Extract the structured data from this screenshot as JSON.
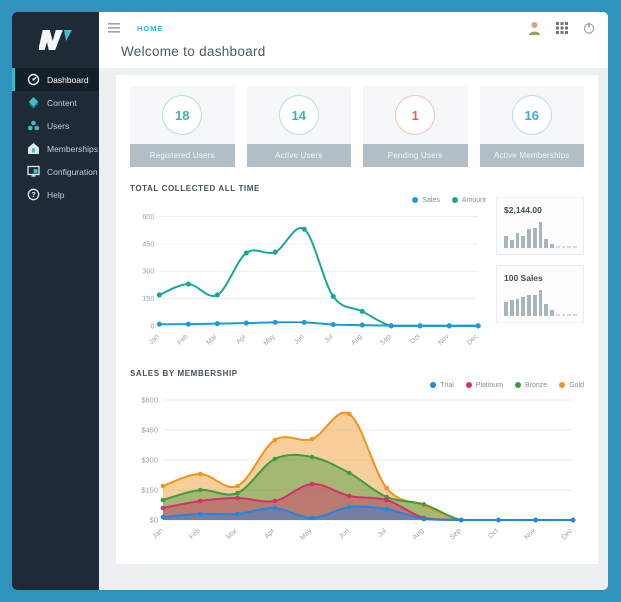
{
  "sidebar": {
    "items": [
      {
        "label": "Dashboard",
        "icon": "dashboard-icon",
        "active": true
      },
      {
        "label": "Content",
        "icon": "content-icon",
        "active": false
      },
      {
        "label": "Users",
        "icon": "users-icon",
        "active": false
      },
      {
        "label": "Memberships",
        "icon": "memberships-icon",
        "active": false
      },
      {
        "label": "Configuration",
        "icon": "configuration-icon",
        "active": false
      },
      {
        "label": "Help",
        "icon": "help-icon",
        "active": false
      }
    ]
  },
  "topbar": {
    "breadcrumb": "HOME",
    "title": "Welcome to dashboard",
    "icons": [
      "user-avatar-icon",
      "grid-menu-icon",
      "power-icon"
    ]
  },
  "stats": [
    {
      "value": "18",
      "label": "Registered Users",
      "color": "#3eb5a0"
    },
    {
      "value": "14",
      "label": "Active Users",
      "color": "#3eb5a0"
    },
    {
      "value": "1",
      "label": "Pending Users",
      "color": "#e2605e"
    },
    {
      "value": "16",
      "label": "Active Memberships",
      "color": "#41a7dd"
    }
  ],
  "mini_cards": [
    {
      "title": "$2,144.00",
      "bars": [
        45,
        30,
        58,
        45,
        75,
        76,
        100,
        36,
        14
      ],
      "dashes": 4
    },
    {
      "title": "100 Sales",
      "bars": [
        55,
        60,
        66,
        72,
        80,
        80,
        100,
        46,
        25
      ],
      "dashes": 4
    }
  ],
  "chart_data": [
    {
      "type": "line",
      "title": "TOTAL COLLECTED ALL TIME",
      "categories": [
        "Jan",
        "Feb",
        "Mar",
        "Apr",
        "May",
        "Jun",
        "Jul",
        "Aug",
        "Sep",
        "Oct",
        "Nov",
        "Dec"
      ],
      "series": [
        {
          "name": "Amount",
          "color": "#16a79b",
          "values": [
            170,
            230,
            170,
            400,
            405,
            530,
            162,
            80,
            0,
            0,
            0,
            0
          ]
        },
        {
          "name": "Sales",
          "color": "#1e9bd7",
          "values": [
            10,
            10,
            13,
            16,
            20,
            20,
            8,
            5,
            2,
            2,
            2,
            2
          ]
        }
      ],
      "legend_order": [
        "Sales",
        "Amount"
      ],
      "ylim": [
        0,
        600
      ],
      "yticks": [
        0,
        150,
        300,
        450,
        600
      ],
      "ytick_prefix": "",
      "grid": true,
      "legend_position": "top-right"
    },
    {
      "type": "area",
      "title": "SALES BY MEMBERSHIP",
      "categories": [
        "Jan",
        "Feb",
        "Mar",
        "Apr",
        "May",
        "Jun",
        "Jul",
        "Aug",
        "Sep",
        "Oct",
        "Nov",
        "Dec"
      ],
      "series": [
        {
          "name": "Gold",
          "color": "#f0941f",
          "values": [
            170,
            230,
            170,
            400,
            405,
            530,
            160,
            72,
            0,
            0,
            0,
            0
          ]
        },
        {
          "name": "Bronze",
          "color": "#3f9c43",
          "values": [
            100,
            150,
            135,
            305,
            315,
            235,
            115,
            78,
            0,
            0,
            0,
            0
          ]
        },
        {
          "name": "Platinum",
          "color": "#d62f6d",
          "values": [
            60,
            95,
            110,
            95,
            180,
            120,
            100,
            10,
            0,
            0,
            0,
            0
          ]
        },
        {
          "name": "Trial",
          "color": "#2286e2",
          "values": [
            15,
            30,
            30,
            60,
            10,
            65,
            55,
            5,
            0,
            0,
            0,
            0
          ]
        }
      ],
      "legend_order": [
        "Trial",
        "Platinum",
        "Bronze",
        "Gold"
      ],
      "ylim": [
        0,
        600
      ],
      "yticks": [
        0,
        150,
        300,
        450,
        600
      ],
      "ytick_prefix": "$",
      "grid": true,
      "legend_position": "top-right"
    }
  ],
  "colors": {
    "frame": "#2e94be",
    "sidebar_bg": "#1e2b37",
    "sidebar_active_bg": "#141f29",
    "accent_teal": "#2ec1c9",
    "footer_gray": "#b2bec5",
    "mini_bar": "#a9b5bd"
  }
}
